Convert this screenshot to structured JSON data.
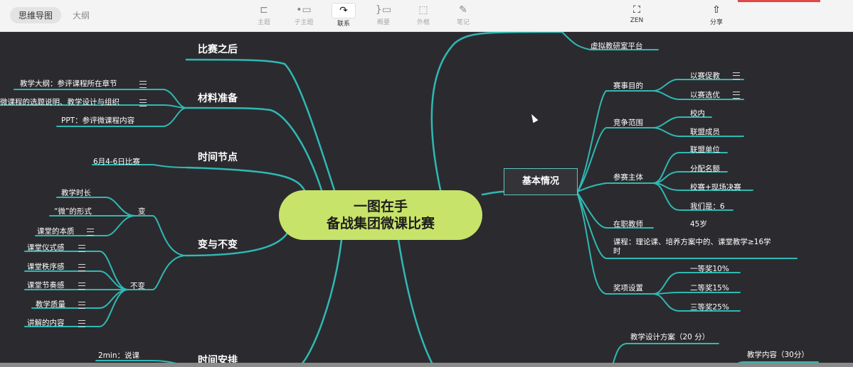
{
  "toolbar": {
    "view_tabs": [
      "思维导图",
      "大纲"
    ],
    "tools": [
      {
        "label": "主题",
        "icon": "topic-icon"
      },
      {
        "label": "子主题",
        "icon": "subtopic-icon"
      },
      {
        "label": "联系",
        "icon": "relation-icon"
      },
      {
        "label": "概要",
        "icon": "summary-icon"
      },
      {
        "label": "外框",
        "icon": "boundary-icon"
      },
      {
        "label": "笔记",
        "icon": "note-icon"
      }
    ],
    "zen_label": "ZEN",
    "share_label": "分享"
  },
  "mindmap": {
    "center": [
      "一图在手",
      "备战集团微课比赛"
    ],
    "left": {
      "after": "比赛之后",
      "materials": {
        "title": "材料准备",
        "items": [
          "教学大纲：参评课程所在章节",
          "微课程的选题说明、教学设计与组织",
          "PPT：参评微课程内容"
        ]
      },
      "timeline": {
        "title": "时间节点",
        "items": [
          "6月4-6日比赛"
        ]
      },
      "change": {
        "title": "变与不变",
        "change_label": "变",
        "change_items": [
          "教学时长",
          "“微”的形式",
          "课堂的本质"
        ],
        "keep_label": "不变",
        "keep_items": [
          "课堂仪式感",
          "课堂秩序感",
          "课堂节奏感",
          "教学质量",
          "讲解的内容"
        ]
      },
      "schedule": {
        "title": "时间安排",
        "items": [
          "2min：说课"
        ]
      }
    },
    "right": {
      "top_item": "虚拟教研室平台",
      "basic": {
        "title": "基本情况",
        "purpose": {
          "label": "赛事目的",
          "items": [
            "以赛促教",
            "以赛选优"
          ]
        },
        "scope": {
          "label": "竞争范围",
          "items": [
            "校内",
            "联盟成员"
          ]
        },
        "subject": {
          "label": "参赛主体",
          "items": [
            "联盟单位",
            "分配名额",
            "校赛+现场决赛",
            "我们是：6"
          ]
        },
        "teacher": {
          "label": "在职教师",
          "value": "45岁"
        },
        "course": [
          "课程：理论课、培养方案中的、课堂教学≥16学",
          "时"
        ],
        "awards": {
          "label": "奖项设置",
          "items": [
            "一等奖10%",
            "二等奖15%",
            "三等奖25%"
          ]
        }
      },
      "design": "教学设计方案（20 分）",
      "content": "教学内容（30分）"
    }
  }
}
